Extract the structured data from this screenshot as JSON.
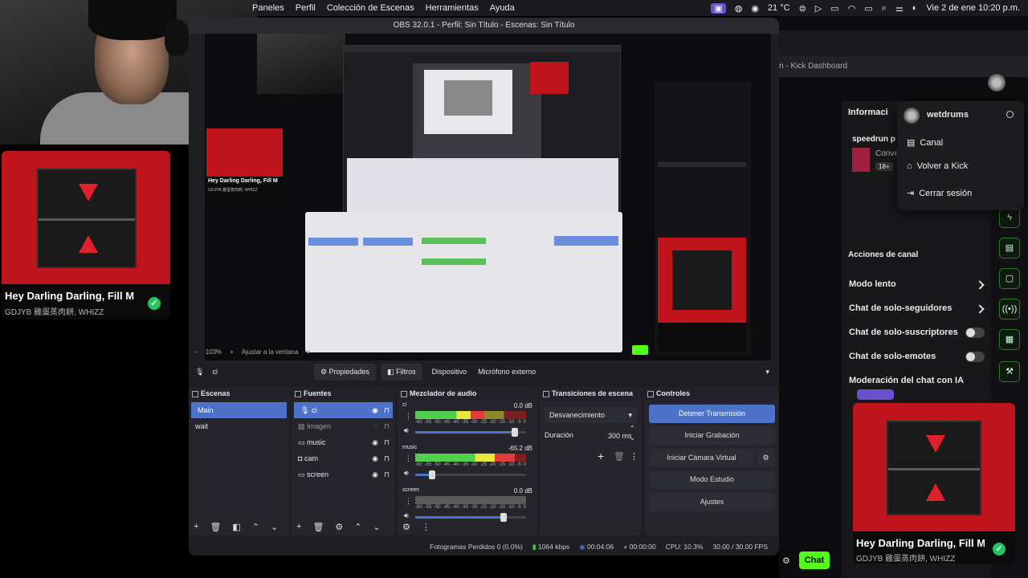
{
  "menubar": {
    "items": [
      "Paneles",
      "Perfil",
      "Colección de Escenas",
      "Herramientas",
      "Ayuda"
    ],
    "temperature": "21 °C",
    "datetime": "Vie 2 de ene  10:20 p.m."
  },
  "now_playing_left": {
    "title": "Hey Darling Darling, Fill M",
    "artist": "GDJYB 雞蛋蒸肉餅, WHIZZ"
  },
  "now_playing_right": {
    "title": "Hey Darling Darling, Fill M",
    "artist": "GDJYB 雞蛋蒸肉餅, WHIZZ"
  },
  "kick": {
    "tab_title": "n - Kick Dashboard",
    "info_title": "Informaci",
    "streamer_line": "speedrun p",
    "convo": "Conve",
    "age_badge": "18+",
    "user_menu": {
      "username": "wetdrums",
      "items": [
        "Canal",
        "Volver a Kick",
        "Cerrar sesión"
      ]
    },
    "channel_actions": {
      "title": "Acciones de canal",
      "rows": [
        "Modo lento",
        "Chat de solo-seguidores",
        "Chat de solo-suscriptores",
        "Chat de solo-emotes",
        "Moderación del chat con IA"
      ]
    },
    "chat_button": "Chat"
  },
  "obs": {
    "window_title": "OBS 32.0.1 - Perfil: Sin Título - Escenas: Sin Título",
    "zoom": "103%",
    "fit_label": "Ajustar a la ventana",
    "source_name": "ci",
    "properties_label": "Propiedades",
    "filters_label": "Filtros",
    "device_label": "Dispositivo",
    "device_value": "Micrófono externo",
    "scenes": {
      "title": "Escenas",
      "items": [
        "Main",
        "wait"
      ]
    },
    "sources": {
      "title": "Fuentes",
      "items": [
        "ci",
        "Imagen",
        "music",
        "cam",
        "screen"
      ]
    },
    "mixer": {
      "title": "Mezclador de audio",
      "channels": [
        {
          "name": "ci",
          "db": "0.0 dB",
          "level": 0.62,
          "volume": 0.9
        },
        {
          "name": "music",
          "db": "-65.2 dB",
          "level": 0.9,
          "volume": 0.15
        },
        {
          "name": "screen",
          "db": "0.0 dB",
          "level": 0.0,
          "volume": 0.8
        }
      ],
      "ticks": [
        "-60",
        "-55",
        "-50",
        "-45",
        "-40",
        "-35",
        "-30",
        "-25",
        "-20",
        "-15",
        "-10",
        "-5",
        "0"
      ]
    },
    "transitions": {
      "title": "Transiciones de escena",
      "selected": "Desvanecimiento",
      "duration_label": "Duración",
      "duration_value": "300 ms"
    },
    "controls": {
      "title": "Controles",
      "buttons": [
        "Detener Transmisión",
        "Iniciar Grabación",
        "Iniciar Cámara Virtual",
        "Modo Estudio",
        "Ajustes"
      ]
    },
    "status": {
      "dropped": "Fotogramas Perdidos 0 (0.0%)",
      "bitrate": "1064 kbps",
      "stream_time": "00:04:06",
      "rec_time": "00:00:00",
      "cpu": "CPU: 10.3%",
      "fps": "30.00 / 30.00 FPS"
    },
    "preview_card": {
      "title": "Hey Darling Darling, Fill M",
      "artist": "GDJYB 雞蛋蒸肉餅, WHIZZ"
    }
  }
}
